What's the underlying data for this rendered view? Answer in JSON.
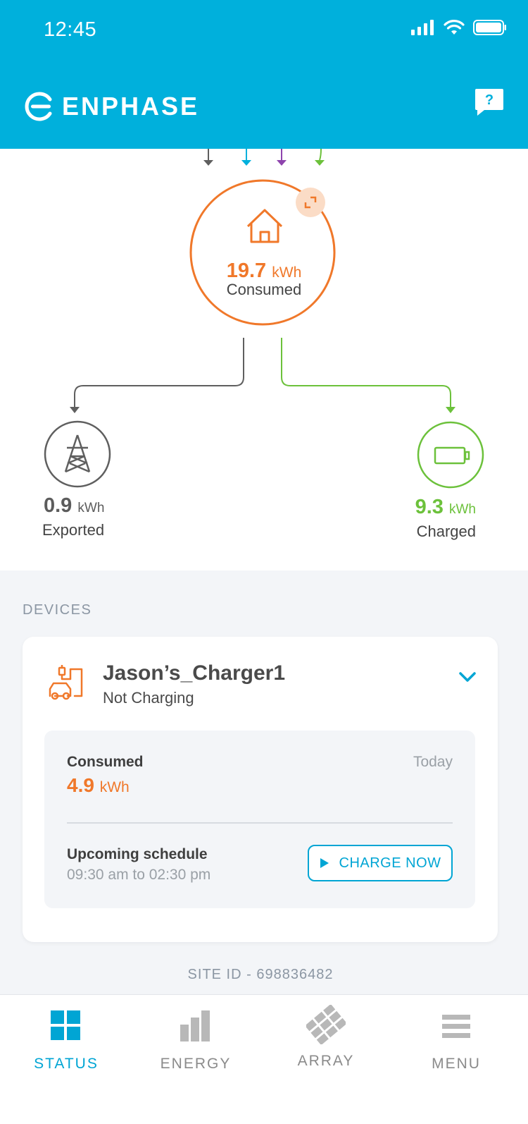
{
  "status_bar": {
    "time": "12:45"
  },
  "header": {
    "brand": "ENPHASE",
    "help_icon": "help-chat-icon"
  },
  "energy_flow": {
    "consumed": {
      "value": "19.7",
      "unit": "kWh",
      "label": "Consumed"
    },
    "exported": {
      "value": "0.9",
      "unit": "kWh",
      "label": "Exported"
    },
    "charged": {
      "value": "9.3",
      "unit": "kWh",
      "label": "Charged"
    },
    "colors": {
      "consumed": "#f0782a",
      "grid": "#5f5f5f",
      "charged": "#6cc13b",
      "solar": "#00b0dc",
      "storage": "#8e44ad"
    }
  },
  "devices": {
    "heading": "DEVICES",
    "device": {
      "name": "Jason’s_Charger1",
      "status": "Not Charging",
      "consumed_label": "Consumed",
      "period": "Today",
      "consumed_value": "4.9",
      "consumed_unit": "kWh",
      "schedule_label": "Upcoming schedule",
      "schedule_time": "09:30 am to 02:30 pm",
      "charge_button": "CHARGE NOW"
    }
  },
  "site_id": "SITE ID - 698836482",
  "tabs": [
    {
      "label": "STATUS",
      "icon": "status-grid-icon",
      "active": true
    },
    {
      "label": "ENERGY",
      "icon": "energy-bars-icon",
      "active": false
    },
    {
      "label": "ARRAY",
      "icon": "array-panels-icon",
      "active": false
    },
    {
      "label": "MENU",
      "icon": "menu-lines-icon",
      "active": false
    }
  ],
  "accent_color": "#00b0dc"
}
